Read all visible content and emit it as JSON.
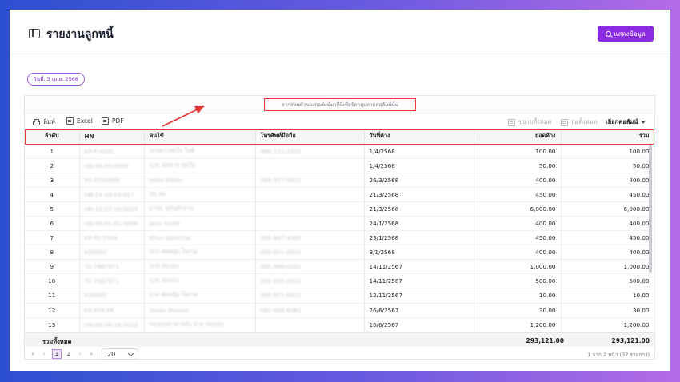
{
  "page": {
    "title": "รายงานลูกหนี้",
    "show_button_label": "แสดงข้อมูล",
    "date_filter": "วันที่: 3 เม.ย. 2568"
  },
  "grid": {
    "group_hint": "ลากส่วนหัวของคอลัมน์มาที่นี่เพื่อจัดกลุ่มตามคอลัมน์นั้น",
    "toolbar": {
      "print": "พิมพ์",
      "excel": "Excel",
      "pdf": "PDF",
      "expand_all": "ขยายทั้งหมด",
      "collapse_all": "ย่อทั้งหมด",
      "choose_columns": "เลือกคอลัมน์"
    },
    "columns": [
      "ลำดับ",
      "HN",
      "คนไข้",
      "โทรศัพท์มือถือ",
      "วันที่ค้าง",
      "ยอดค้าง",
      "รวม"
    ],
    "rows": [
      {
        "idx": "1",
        "hn": "KP-P-0001",
        "patient": "นางสาวสมใจ ใจดี",
        "phone": "099-111-2222",
        "date": "1/4/2568",
        "amount": "100.00",
        "total": "100.00"
      },
      {
        "idx": "2",
        "hn": "HN-04-03-0098",
        "patient": "นาย สมชาย สุขใจ",
        "phone": "",
        "date": "1/4/2568",
        "amount": "50.00",
        "total": "50.00"
      },
      {
        "idx": "3",
        "hn": "P0-2503056",
        "patient": "Hello Kitten",
        "phone": "085-357-0001",
        "date": "26/3/2568",
        "amount": "400.00",
        "total": "400.00"
      },
      {
        "idx": "4",
        "hn": "HN-14-16-04-017",
        "patient": "สุข สม",
        "phone": "",
        "date": "21/3/2568",
        "amount": "450.00",
        "total": "450.00"
      },
      {
        "idx": "5",
        "hn": "HN-14-15-06-0004",
        "patient": "มานะ ขยันทำงาน",
        "phone": "",
        "date": "21/3/2568",
        "amount": "6,000.00",
        "total": "6,000.00"
      },
      {
        "idx": "6",
        "hn": "HN-06-01-01-0008",
        "patient": "Jane Smith",
        "phone": "",
        "date": "24/1/2568",
        "amount": "400.00",
        "total": "400.00"
      },
      {
        "idx": "7",
        "hn": "KP-P0-2504",
        "patient": "Khun Somchai",
        "phone": "091-847-4365",
        "date": "23/1/2568",
        "amount": "450.00",
        "total": "450.00"
      },
      {
        "idx": "8",
        "hn": "K00000",
        "patient": "นาง สมหญิง ใจงาม",
        "phone": "095-951-0001",
        "date": "8/1/2568",
        "amount": "400.00",
        "total": "400.00"
      },
      {
        "idx": "9",
        "hn": "T0-7887871",
        "patient": "นาย สมปอง",
        "phone": "095-996-0001",
        "date": "14/11/2567",
        "amount": "1,000.00",
        "total": "1,000.00"
      },
      {
        "idx": "10",
        "hn": "T0-7887871",
        "patient": "นาย สมปอง",
        "phone": "095-996-0001",
        "date": "14/11/2567",
        "amount": "500.00",
        "total": "500.00"
      },
      {
        "idx": "11",
        "hn": "K00000",
        "patient": "นาง สมหญิง ใจงาม",
        "phone": "095-951-0001",
        "date": "12/11/2567",
        "amount": "10.00",
        "total": "10.00"
      },
      {
        "idx": "12",
        "hn": "KA-P74-PR",
        "patient": "Vision Bunma",
        "phone": "061-856-8062",
        "date": "26/6/2567",
        "amount": "30.00",
        "total": "30.00"
      },
      {
        "idx": "13",
        "hn": "HN-04-06-16-0023",
        "patient": "ทดสอบสาขาหลัง นาย ทดสอบ",
        "phone": "",
        "date": "16/6/2567",
        "amount": "1,200.00",
        "total": "1,200.00"
      }
    ],
    "totals": {
      "label": "รวมทั้งหมด",
      "amount": "293,121.00",
      "total": "293,121.00"
    },
    "pager": {
      "first": "«",
      "prev": "‹",
      "pages": [
        "1",
        "2"
      ],
      "current": "1",
      "next": "›",
      "last": "»",
      "page_size": "20",
      "info": "1 จาก 2 หน้า (37 รายการ)"
    }
  },
  "colors": {
    "accent": "#8a2be2",
    "annotation": "#e53935"
  }
}
